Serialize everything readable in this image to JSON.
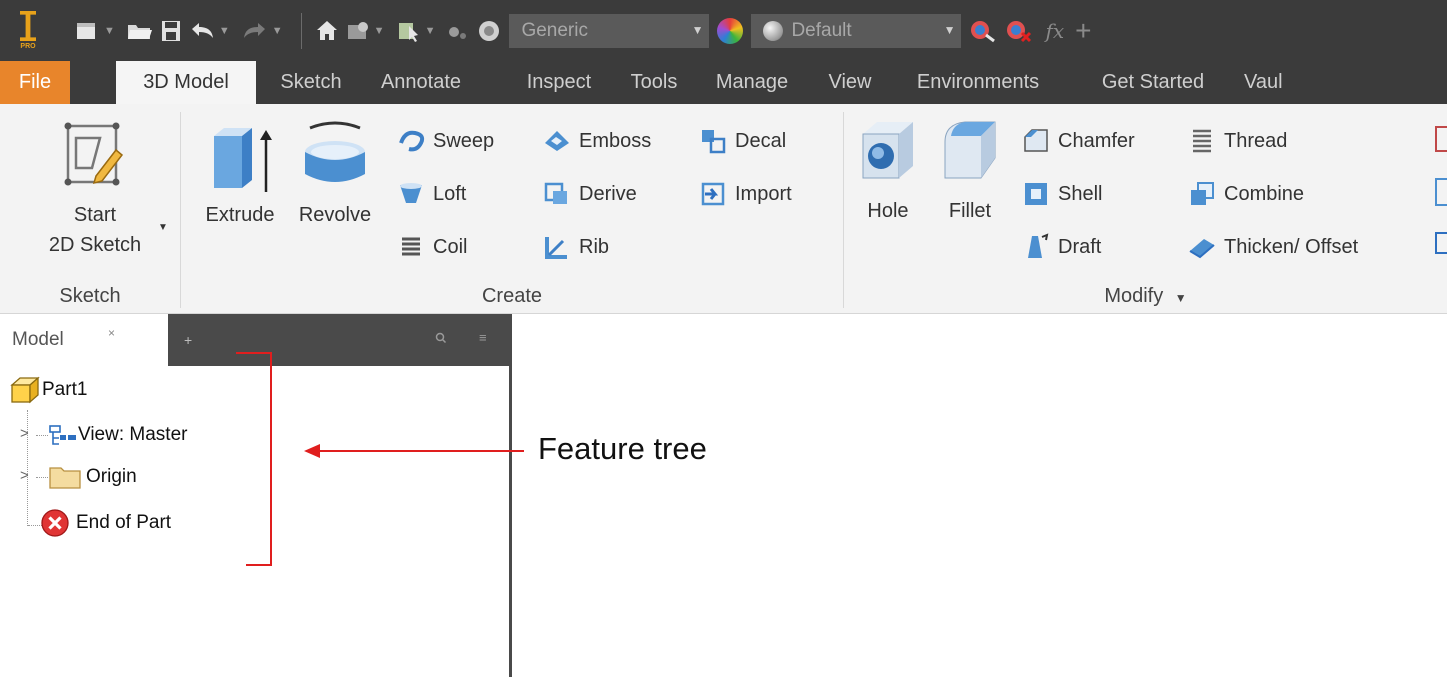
{
  "quick_access": {
    "material_select": "Generic",
    "appearance_select": "Default",
    "fx_label": "fx",
    "add_label": "+"
  },
  "tabs": [
    {
      "label": "File"
    },
    {
      "label": "3D Model"
    },
    {
      "label": "Sketch"
    },
    {
      "label": "Annotate"
    },
    {
      "label": "Inspect"
    },
    {
      "label": "Tools"
    },
    {
      "label": "Manage"
    },
    {
      "label": "View"
    },
    {
      "label": "Environments"
    },
    {
      "label": "Get Started"
    },
    {
      "label": "Vaul"
    }
  ],
  "ribbon": {
    "sketch_panel": {
      "title": "Sketch",
      "start_sketch_line1": "Start",
      "start_sketch_line2": "2D Sketch"
    },
    "create_panel": {
      "title": "Create",
      "extrude": "Extrude",
      "revolve": "Revolve",
      "sweep": "Sweep",
      "loft": "Loft",
      "coil": "Coil",
      "emboss": "Emboss",
      "derive": "Derive",
      "rib": "Rib",
      "decal": "Decal",
      "import": "Import"
    },
    "modify_panel": {
      "title": "Modify",
      "hole": "Hole",
      "fillet": "Fillet",
      "chamfer": "Chamfer",
      "shell": "Shell",
      "draft": "Draft",
      "thread": "Thread",
      "combine": "Combine",
      "thicken_offset": "Thicken/ Offset"
    }
  },
  "browser": {
    "tab_label": "Model",
    "close_glyph": "×",
    "tree": [
      {
        "label": "Part1"
      },
      {
        "label": "View: Master"
      },
      {
        "label": "Origin"
      },
      {
        "label": "End of Part"
      }
    ]
  },
  "annotation": {
    "label": "Feature tree",
    "color": "#e01e1e"
  },
  "colors": {
    "toolbar_bg": "#3b3b3b",
    "file_tab": "#e8852b",
    "ribbon_bg": "#f3f3f3",
    "browser_header": "#4a4a4a"
  }
}
